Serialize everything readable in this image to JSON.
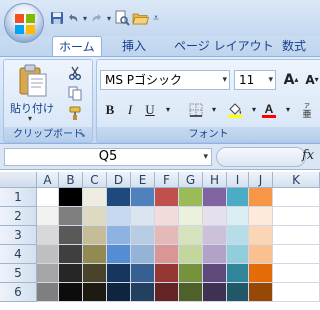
{
  "quick_access": {
    "save_icon": "save-icon",
    "undo_icon": "undo-icon",
    "redo_icon": "redo-icon",
    "print_preview_icon": "print-preview-icon",
    "open_icon": "open-folder-icon",
    "customize_icon": "customize-qat-icon"
  },
  "tabs": [
    {
      "label": "ホーム",
      "active": true
    },
    {
      "label": "挿入",
      "active": false
    },
    {
      "label": "ページ レイアウト",
      "active": false
    },
    {
      "label": "数式",
      "active": false
    }
  ],
  "clipboard": {
    "paste_label": "貼り付け",
    "group_label": "クリップボード"
  },
  "font": {
    "name": "MS Pゴシック",
    "size": "11",
    "group_label": "フォント",
    "bold": "B",
    "italic": "I",
    "underline": "U",
    "grow": "A",
    "shrink": "A"
  },
  "formula_bar": {
    "name_box": "Q5",
    "fx_label": "fx"
  },
  "columns": [
    "A",
    "B",
    "C",
    "D",
    "E",
    "F",
    "G",
    "H",
    "I",
    "J",
    "K"
  ],
  "rows": [
    "1",
    "2",
    "3",
    "4",
    "5",
    "6"
  ],
  "palette": [
    [
      "#ffffff",
      "#000000",
      "#eeece1",
      "#1f497d",
      "#4f81bd",
      "#c0504d",
      "#9bbb59",
      "#8064a2",
      "#4bacc6",
      "#f79646"
    ],
    [
      "#f2f2f2",
      "#7f7f7f",
      "#ddd9c3",
      "#c6d9f0",
      "#dbe5f1",
      "#f2dcdb",
      "#ebf1dd",
      "#e5e0ec",
      "#dbeef3",
      "#fdeada"
    ],
    [
      "#d8d8d8",
      "#595959",
      "#c4bd97",
      "#8db3e2",
      "#b8cce4",
      "#e5b9b7",
      "#d7e3bc",
      "#ccc1d9",
      "#b7dde8",
      "#fbd5b5"
    ],
    [
      "#bfbfbf",
      "#3f3f3f",
      "#938953",
      "#548dd4",
      "#95b3d7",
      "#d99694",
      "#c3d69b",
      "#b2a2c7",
      "#92cddc",
      "#fac08f"
    ],
    [
      "#a5a5a5",
      "#262626",
      "#494429",
      "#17365d",
      "#366092",
      "#953734",
      "#76923c",
      "#5f497a",
      "#31859b",
      "#e36c09"
    ],
    [
      "#7f7f7f",
      "#0c0c0c",
      "#1d1b10",
      "#0f243e",
      "#244061",
      "#632423",
      "#4f6128",
      "#3f3151",
      "#205867",
      "#974806"
    ]
  ]
}
